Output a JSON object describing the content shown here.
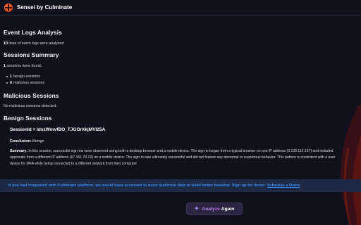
{
  "header": {
    "title": "Sensei by Culminate"
  },
  "event_logs": {
    "heading": "Event Logs Analysis",
    "count": "10",
    "text": "lines of event logs were analyzed."
  },
  "sessions_summary": {
    "heading": "Sessions Summary",
    "found_count": "1",
    "found_text": "sessions were found:",
    "items": [
      {
        "count": "1",
        "label": "benign sessions"
      },
      {
        "count": "0",
        "label": "malicious sessions"
      }
    ]
  },
  "malicious": {
    "heading": "Malicious Sessions",
    "text": "No malicious sessions detected."
  },
  "benign": {
    "heading": "Benign Sessions",
    "session_id": "SessionId = ldxzWmvfBO_TJGOrXkjMVI25A",
    "conclusion_label": "Conclusion:",
    "conclusion_value": "Benign",
    "summary_label": "Summary:",
    "summary_line1": "In this session, successful sign-ins were observed using both a desktop browser and a mobile device. The sign-in began from a typical browser on one IP address (3.128.112.137) and included",
    "summary_line2": "approvals from a different IP address (67.161.78.23) on a mobile device. The sign-in was ultimately successful and did not feature any abnormal or suspicious behavior. This pattern is consistent with a user",
    "summary_line3": "device for MFA while being connected to a different network from their computer."
  },
  "banner": {
    "text": "If you had integrated with Culminate platform, we would have accessed to more historical data to build better baseline. Sign up for demo:",
    "link": "Schedule a Demo"
  },
  "analyze_button": {
    "part1": "Analy",
    "part2": "ze ",
    "part3": "Again"
  },
  "colors": {
    "background": "#11111d",
    "accent": "#e34b10",
    "banner_bg": "#1e2a45",
    "banner_text": "#3b8bf0"
  }
}
